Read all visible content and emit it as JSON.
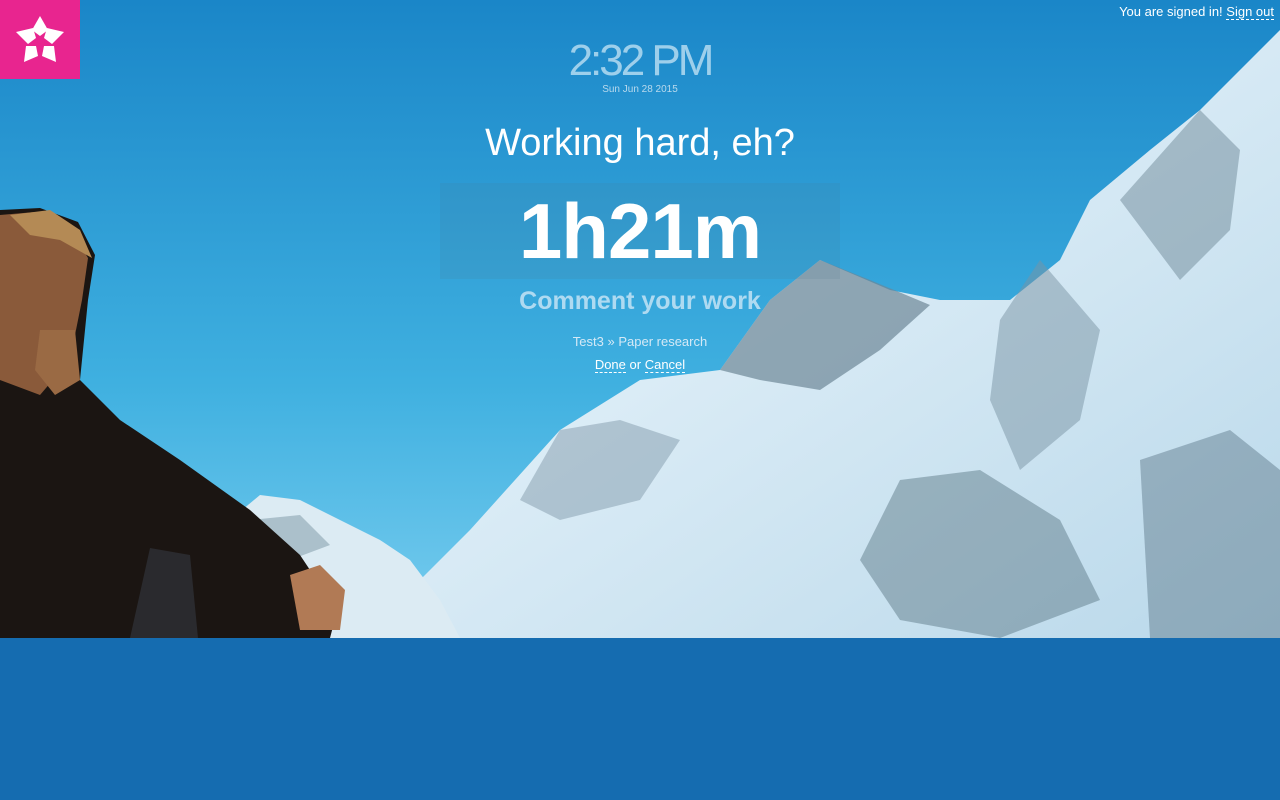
{
  "header": {
    "signin_text": "You are signed in!",
    "signout_label": "Sign out"
  },
  "logo": {
    "icon": "flower-icon",
    "color": "#e8258f"
  },
  "clock": {
    "time": "2:32 PM",
    "date": "Sun Jun 28 2015"
  },
  "main": {
    "greeting": "Working hard, eh?",
    "timer": "1h21m",
    "comment_placeholder": "Comment your work",
    "project": "Test3",
    "separator": "»",
    "task": "Paper research",
    "done_label": "Done",
    "or_text": "or",
    "cancel_label": "Cancel"
  },
  "colors": {
    "background": "#156cb0",
    "sky": "#1f8fd0",
    "snow": "#eef6fb"
  }
}
